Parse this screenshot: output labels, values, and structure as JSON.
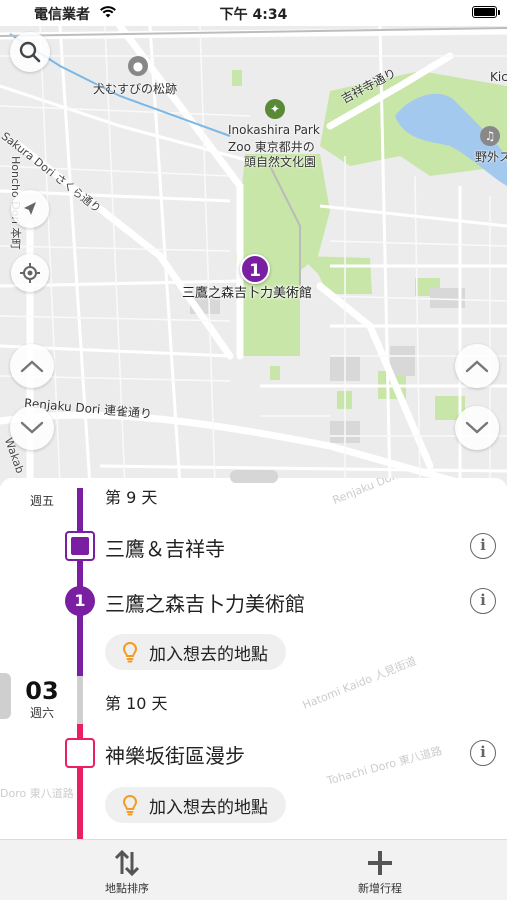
{
  "status_bar": {
    "carrier": "電信業者",
    "time": "下午 4:34"
  },
  "map": {
    "labels": {
      "inu_musubi": "犬むすびの松跡",
      "kichijoji_dori": "吉祥寺通り",
      "inokashira_zoo_en": "Inokashira Park",
      "inokashira_zoo_jp1": "Zoo 東京都井の",
      "inokashira_zoo_jp2": "頭自然文化園",
      "sakura_dori": "Sakura Dori さくら通り",
      "honcho_dori": "Honcho Dori 本町",
      "renjaku_dori": "Renjaku Dori 連雀通り",
      "wakaba": "Wakab",
      "outdoor_stage": "野外ステ",
      "ki": "Kic",
      "renjaku_dori_2": "Renjaku Dori 連雀通り"
    },
    "pin": {
      "number": "1",
      "label": "三鷹之森吉卜力美術館"
    },
    "colors": {
      "park": "#c8e6a8",
      "water": "#a3c9ef",
      "road": "#ffffff"
    }
  },
  "itinerary": {
    "day9": {
      "date_dow": "週五",
      "title": "第 9 天"
    },
    "day10": {
      "date_num": "03",
      "date_dow": "週六",
      "title": "第 10 天"
    },
    "places": [
      {
        "name": "三鷹＆吉祥寺"
      },
      {
        "name": "三鷹之森吉卜力美術館",
        "number": "1"
      },
      {
        "name": "神樂坂街區漫步"
      }
    ],
    "add_place_label": "加入想去的地點",
    "background_labels": {
      "hatomi": "Hatomi Kaido 人見街道",
      "tohachi": "Tohachi Doro 東八道路",
      "renjaku_bg": "Renjaku Dori 連雀通り",
      "tohachi_left": "Doro 東八道路"
    },
    "colors": {
      "day9": "#7b1fa2",
      "day10": "#e91e63",
      "chip_icon": "#f59a23"
    }
  },
  "tabbar": {
    "sort_label": "地點排序",
    "add_trip_label": "新增行程"
  }
}
